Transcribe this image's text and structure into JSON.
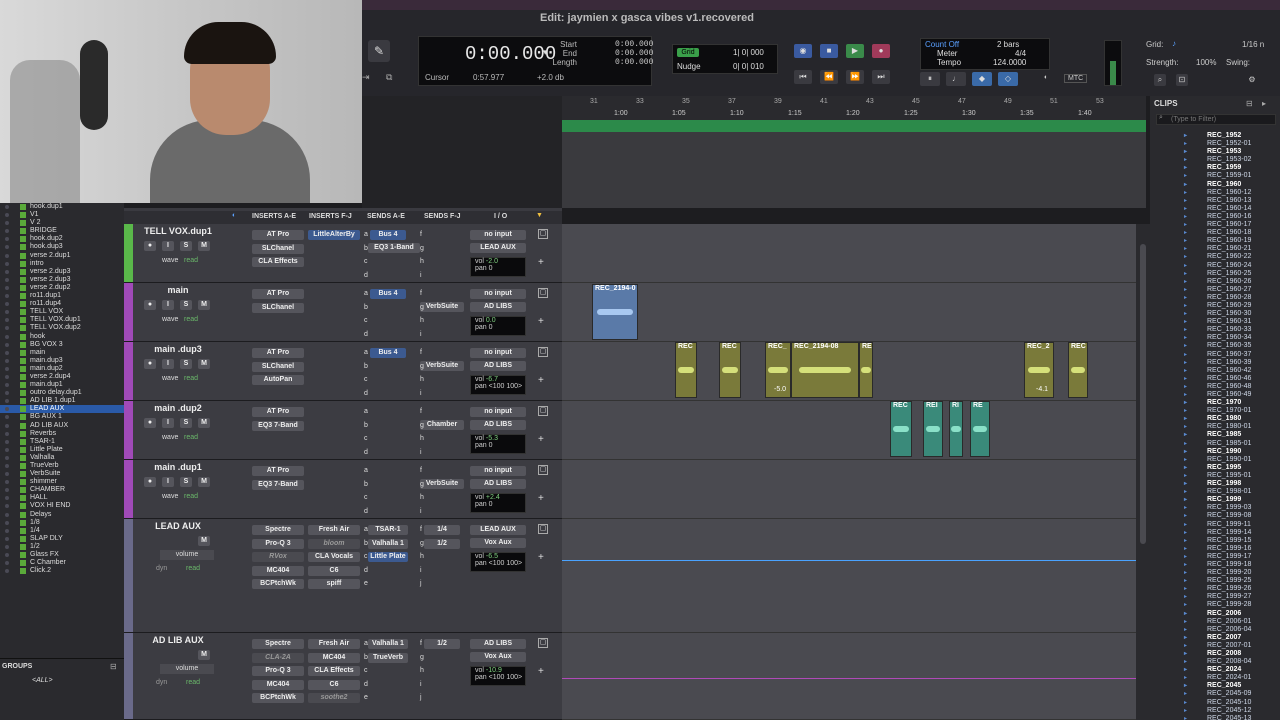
{
  "window": {
    "title": "Edit: jaymien x gasca vibes v1.recovered"
  },
  "counter": {
    "main": "0:00.000",
    "start_label": "Start",
    "end_label": "End",
    "length_label": "Length",
    "start": "0:00.000",
    "end": "0:00.000",
    "length": "0:00.000",
    "cursor_label": "Cursor",
    "cursor": "0:57.977",
    "gain": "+2.0 db"
  },
  "gridnudge": {
    "grid_label": "Grid",
    "grid": "1| 0| 000",
    "nudge_label": "Nudge",
    "nudge": "0| 0| 010"
  },
  "countoff": {
    "count_off": "Count Off",
    "bars": "2 bars",
    "meter_label": "Meter",
    "meter": "4/4",
    "tempo_label": "Tempo",
    "tempo": "124.0000"
  },
  "transport": {
    "mtc": "MTC"
  },
  "gridpanel": {
    "grid_label": "Grid:",
    "grid_val": "1/16 n",
    "strength_label": "Strength:",
    "strength": "100%",
    "swing_label": "Swing:"
  },
  "ruler": {
    "bars": [
      "31",
      "33",
      "35",
      "37",
      "39",
      "41",
      "43",
      "45",
      "47",
      "49",
      "51",
      "53"
    ],
    "times": [
      "1:00",
      "1:05",
      "1:10",
      "1:15",
      "1:20",
      "1:25",
      "1:30",
      "1:35",
      "1:40"
    ]
  },
  "scale": {
    "labels": [
      "500",
      "300",
      "200",
      "150"
    ]
  },
  "left_list": [
    {
      "name": "hook.dup1"
    },
    {
      "name": "V1"
    },
    {
      "name": "V 2"
    },
    {
      "name": "BRIDGE"
    },
    {
      "name": "hook.dup2"
    },
    {
      "name": "hook.dup3"
    },
    {
      "name": "verse 2.dup1"
    },
    {
      "name": "intro"
    },
    {
      "name": "verse 2.dup3"
    },
    {
      "name": "verse 2.dup3"
    },
    {
      "name": "verse 2.dup2"
    },
    {
      "name": "ro11.dup1"
    },
    {
      "name": "ro11.dup4"
    },
    {
      "name": "TELL VOX"
    },
    {
      "name": "TELL VOX.dup1"
    },
    {
      "name": "TELL VOX.dup2"
    },
    {
      "name": "hook"
    },
    {
      "name": "BG VOX 3"
    },
    {
      "name": "main"
    },
    {
      "name": "main.dup3"
    },
    {
      "name": "main.dup2"
    },
    {
      "name": "verse 2.dup4"
    },
    {
      "name": "main.dup1"
    },
    {
      "name": "outro delay.dup1"
    },
    {
      "name": "AD LIB 1.dup1"
    },
    {
      "name": "LEAD AUX"
    },
    {
      "name": "BG AUX 1"
    },
    {
      "name": "AD LIB AUX"
    },
    {
      "name": "Reverbs"
    },
    {
      "name": "TSAR-1"
    },
    {
      "name": "Little Plate"
    },
    {
      "name": "Valhalla"
    },
    {
      "name": "TrueVerb"
    },
    {
      "name": "VerbSuite"
    },
    {
      "name": "shimmer"
    },
    {
      "name": "CHAMBER"
    },
    {
      "name": "HALL"
    },
    {
      "name": "VOX HI END"
    },
    {
      "name": "Delays"
    },
    {
      "name": "1/8"
    },
    {
      "name": "1/4"
    },
    {
      "name": "SLAP DLY"
    },
    {
      "name": "1/2"
    },
    {
      "name": "Glass FX"
    },
    {
      "name": "C Chamber"
    },
    {
      "name": "Click.2"
    }
  ],
  "groups": {
    "title": "GROUPS",
    "all": "<ALL>"
  },
  "mixer_header": {
    "inserts_ae": "INSERTS A-E",
    "inserts_fj": "INSERTS F-J",
    "sends_ae": "SENDS A-E",
    "sends_fj": "SENDS F-J",
    "io": "I / O"
  },
  "tracks": [
    {
      "name": "TELL VOX.dup1",
      "ins": [
        "AT Pro",
        "SLChanel",
        "CLA Effects"
      ],
      "insfj": [
        "LittleAlterBy",
        ""
      ],
      "send_a": "Bus 4",
      "send_b": "EQ3 1-Band",
      "io_in": "no input",
      "io_out": "LEAD AUX",
      "vol": "-2.0",
      "pan": "0",
      "mode": "read"
    },
    {
      "name": "main",
      "ins": [
        "AT Pro",
        "SLChanel"
      ],
      "send_a": "Bus 4",
      "send_g": "VerbSuite",
      "io_in": "no input",
      "io_out": "AD LIBS",
      "vol": "0.0",
      "pan": "0",
      "mode": "read"
    },
    {
      "name": "main .dup3",
      "ins": [
        "AT Pro",
        "SLChanel",
        "AutoPan"
      ],
      "send_a": "Bus 4",
      "send_g": "VerbSuite",
      "io_in": "no input",
      "io_out": "AD LIBS",
      "vol": "-6.7",
      "pan": "<100  100>",
      "mode": "read"
    },
    {
      "name": "main .dup2",
      "ins": [
        "AT Pro",
        "EQ3 7-Band"
      ],
      "send_g": "Chamber",
      "io_in": "no input",
      "io_out": "AD LIBS",
      "vol": "-5.3",
      "pan": "0",
      "mode": "read"
    },
    {
      "name": "main .dup1",
      "ins": [
        "AT Pro",
        "EQ3 7-Band"
      ],
      "send_g": "VerbSuite",
      "io_in": "no input",
      "io_out": "AD LIBS",
      "vol": "+2.4",
      "pan": "0",
      "mode": "read"
    },
    {
      "name": "LEAD AUX",
      "ins": [
        "Spectre",
        "Pro-Q 3",
        "RVox",
        "MC404",
        "BCPtchWk"
      ],
      "insfj": [
        "Fresh Air",
        "bloom",
        "CLA Vocals",
        "C6",
        "spiff"
      ],
      "sends": [
        "TSAR-1",
        "Valhalla 1",
        "Little Plate"
      ],
      "sends_fj": [
        "1/4",
        "1/2"
      ],
      "io_in": "LEAD AUX",
      "io_out": "Vox Aux",
      "vol": "-6.5",
      "pan": "<100  100>",
      "volume_label": "volume",
      "dyn": "dyn",
      "mode": "read"
    },
    {
      "name": "AD LIB AUX",
      "ins": [
        "Spectre",
        "CLA-2A",
        "Pro-Q 3",
        "MC404",
        "BCPtchWk"
      ],
      "insfj": [
        "Fresh Air",
        "MC404",
        "CLA Effects",
        "C6",
        "soothe2"
      ],
      "sends": [
        "Valhalla 1",
        "TrueVerb"
      ],
      "sends_fj": [
        "1/2"
      ],
      "io_in": "AD LIBS",
      "io_out": "Vox Aux",
      "vol": "-10.9",
      "pan": "<100  100>",
      "volume_label": "volume",
      "dyn": "dyn",
      "mode": "read"
    }
  ],
  "clips_panel": {
    "title": "CLIPS",
    "filter_placeholder": "(Type to Filter)",
    "items": [
      {
        "n": "REC_1952",
        "b": true
      },
      {
        "n": "REC_1952-01",
        "b": false
      },
      {
        "n": "REC_1953",
        "b": true
      },
      {
        "n": "REC_1953-02",
        "b": false
      },
      {
        "n": "REC_1959",
        "b": true
      },
      {
        "n": "REC_1959-01",
        "b": false
      },
      {
        "n": "REC_1960",
        "b": true
      },
      {
        "n": "REC_1960-12",
        "b": false
      },
      {
        "n": "REC_1960-13",
        "b": false
      },
      {
        "n": "REC_1960-14",
        "b": false
      },
      {
        "n": "REC_1960-16",
        "b": false
      },
      {
        "n": "REC_1960-17",
        "b": false
      },
      {
        "n": "REC_1960-18",
        "b": false
      },
      {
        "n": "REC_1960-19",
        "b": false
      },
      {
        "n": "REC_1960-21",
        "b": false
      },
      {
        "n": "REC_1960-22",
        "b": false
      },
      {
        "n": "REC_1960-24",
        "b": false
      },
      {
        "n": "REC_1960-25",
        "b": false
      },
      {
        "n": "REC_1960-26",
        "b": false
      },
      {
        "n": "REC_1960-27",
        "b": false
      },
      {
        "n": "REC_1960-28",
        "b": false
      },
      {
        "n": "REC_1960-29",
        "b": false
      },
      {
        "n": "REC_1960-30",
        "b": false
      },
      {
        "n": "REC_1960-31",
        "b": false
      },
      {
        "n": "REC_1960-33",
        "b": false
      },
      {
        "n": "REC_1960-34",
        "b": false
      },
      {
        "n": "REC_1960-35",
        "b": false
      },
      {
        "n": "REC_1960-37",
        "b": false
      },
      {
        "n": "REC_1960-39",
        "b": false
      },
      {
        "n": "REC_1960-42",
        "b": false
      },
      {
        "n": "REC_1960-46",
        "b": false
      },
      {
        "n": "REC_1960-48",
        "b": false
      },
      {
        "n": "REC_1960-49",
        "b": false
      },
      {
        "n": "REC_1970",
        "b": true
      },
      {
        "n": "REC_1970-01",
        "b": false
      },
      {
        "n": "REC_1980",
        "b": true
      },
      {
        "n": "REC_1980-01",
        "b": false
      },
      {
        "n": "REC_1985",
        "b": true
      },
      {
        "n": "REC_1985-01",
        "b": false
      },
      {
        "n": "REC_1990",
        "b": true
      },
      {
        "n": "REC_1990-01",
        "b": false
      },
      {
        "n": "REC_1995",
        "b": true
      },
      {
        "n": "REC_1995-01",
        "b": false
      },
      {
        "n": "REC_1998",
        "b": true
      },
      {
        "n": "REC_1998-01",
        "b": false
      },
      {
        "n": "REC_1999",
        "b": true
      },
      {
        "n": "REC_1999-03",
        "b": false
      },
      {
        "n": "REC_1999-08",
        "b": false
      },
      {
        "n": "REC_1999-11",
        "b": false
      },
      {
        "n": "REC_1999-14",
        "b": false
      },
      {
        "n": "REC_1999-15",
        "b": false
      },
      {
        "n": "REC_1999-16",
        "b": false
      },
      {
        "n": "REC_1999-17",
        "b": false
      },
      {
        "n": "REC_1999-18",
        "b": false
      },
      {
        "n": "REC_1999-20",
        "b": false
      },
      {
        "n": "REC_1999-25",
        "b": false
      },
      {
        "n": "REC_1999-26",
        "b": false
      },
      {
        "n": "REC_1999-27",
        "b": false
      },
      {
        "n": "REC_1999-28",
        "b": false
      },
      {
        "n": "REC_2006",
        "b": true
      },
      {
        "n": "REC_2006-01",
        "b": false
      },
      {
        "n": "REC_2006-04",
        "b": false
      },
      {
        "n": "REC_2007",
        "b": true
      },
      {
        "n": "REC_2007-01",
        "b": false
      },
      {
        "n": "REC_2008",
        "b": true
      },
      {
        "n": "REC_2008-04",
        "b": false
      },
      {
        "n": "REC_2024",
        "b": true
      },
      {
        "n": "REC_2024-01",
        "b": false
      },
      {
        "n": "REC_2045",
        "b": true
      },
      {
        "n": "REC_2045-09",
        "b": false
      },
      {
        "n": "REC_2045-10",
        "b": false
      },
      {
        "n": "REC_2045-12",
        "b": false
      },
      {
        "n": "REC_2045-13",
        "b": false
      }
    ]
  },
  "clips": [
    {
      "label": "REC_2194-0"
    },
    {
      "label": "REC"
    },
    {
      "label": "REC"
    },
    {
      "label": "REC_"
    },
    {
      "label": "REC_2194-08"
    },
    {
      "label": "RE"
    },
    {
      "label": "REC_2"
    },
    {
      "label": "REC"
    },
    {
      "label": "REC"
    },
    {
      "label": "REI"
    },
    {
      "label": "RI"
    },
    {
      "label": "RE"
    }
  ],
  "clip_values": {
    "a": "-5.0",
    "b": "-4.1"
  }
}
